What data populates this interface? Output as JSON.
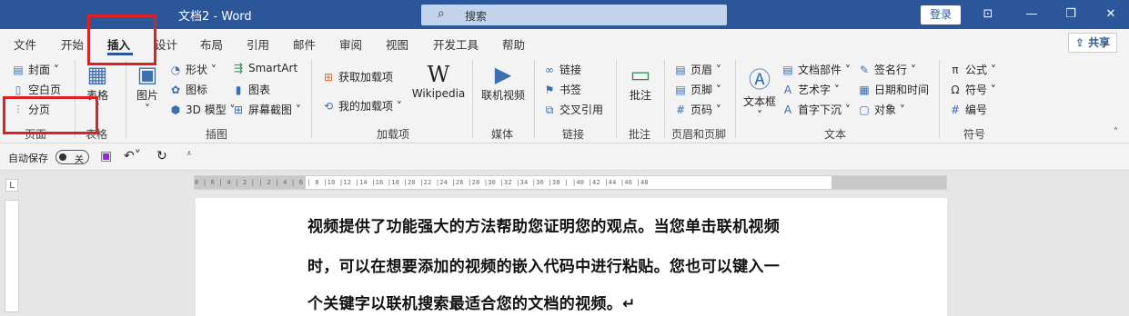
{
  "title": "文档2 - Word",
  "search": {
    "placeholder": "搜索"
  },
  "login": "登录",
  "share": "共享",
  "tabs": [
    "文件",
    "开始",
    "插入",
    "设计",
    "布局",
    "引用",
    "邮件",
    "审阅",
    "视图",
    "开发工具",
    "帮助"
  ],
  "active_tab": "插入",
  "ribbon": {
    "pages": {
      "cover": "封面",
      "blank": "空白页",
      "break": "分页",
      "label": "页面"
    },
    "tables": {
      "table": "表格",
      "label": "表格"
    },
    "illustrations": {
      "picture": "图片",
      "shapes": "形状",
      "icons": "图标",
      "model3d": "3D 模型",
      "smartart": "SmartArt",
      "chart": "图表",
      "screenshot": "屏幕截图",
      "label": "插图"
    },
    "addins": {
      "get": "获取加载项",
      "my": "我的加载项",
      "wikipedia": "Wikipedia",
      "label": "加载项"
    },
    "media": {
      "video": "联机视频",
      "label": "媒体"
    },
    "links": {
      "link": "链接",
      "bookmark": "书签",
      "cross": "交叉引用",
      "label": "链接"
    },
    "comments": {
      "comment": "批注",
      "label": "批注"
    },
    "headerfooter": {
      "header": "页眉",
      "footer": "页脚",
      "pagenum": "页码",
      "label": "页眉和页脚"
    },
    "text": {
      "textbox": "文本框",
      "parts": "文档部件",
      "wordart": "艺术字",
      "dropcap": "首字下沉",
      "signature": "签名行",
      "datetime": "日期和时间",
      "object": "对象",
      "label": "文本"
    },
    "symbols": {
      "equation": "公式",
      "symbol": "符号",
      "number": "编号",
      "label": "符号"
    }
  },
  "qat": {
    "autosave": "自动保存",
    "toggle": "关"
  },
  "ruler_text": "8 | 6 | 4 | 2 | | 2 | 4 | 6 | 8 |10 |12 |14 |16 |18 |20 |22 |24 |26 |28 |30 |32 |34 |36 |38 | |40 |42 |44 |46 |48",
  "document": {
    "line1": "视频提供了功能强大的方法帮助您证明您的观点。当您单击联机视频",
    "line2": "时，可以在想要添加的视频的嵌入代码中进行粘贴。您也可以键入一",
    "line3": "个关键字以联机搜索最适合您的文档的视频。↵"
  }
}
